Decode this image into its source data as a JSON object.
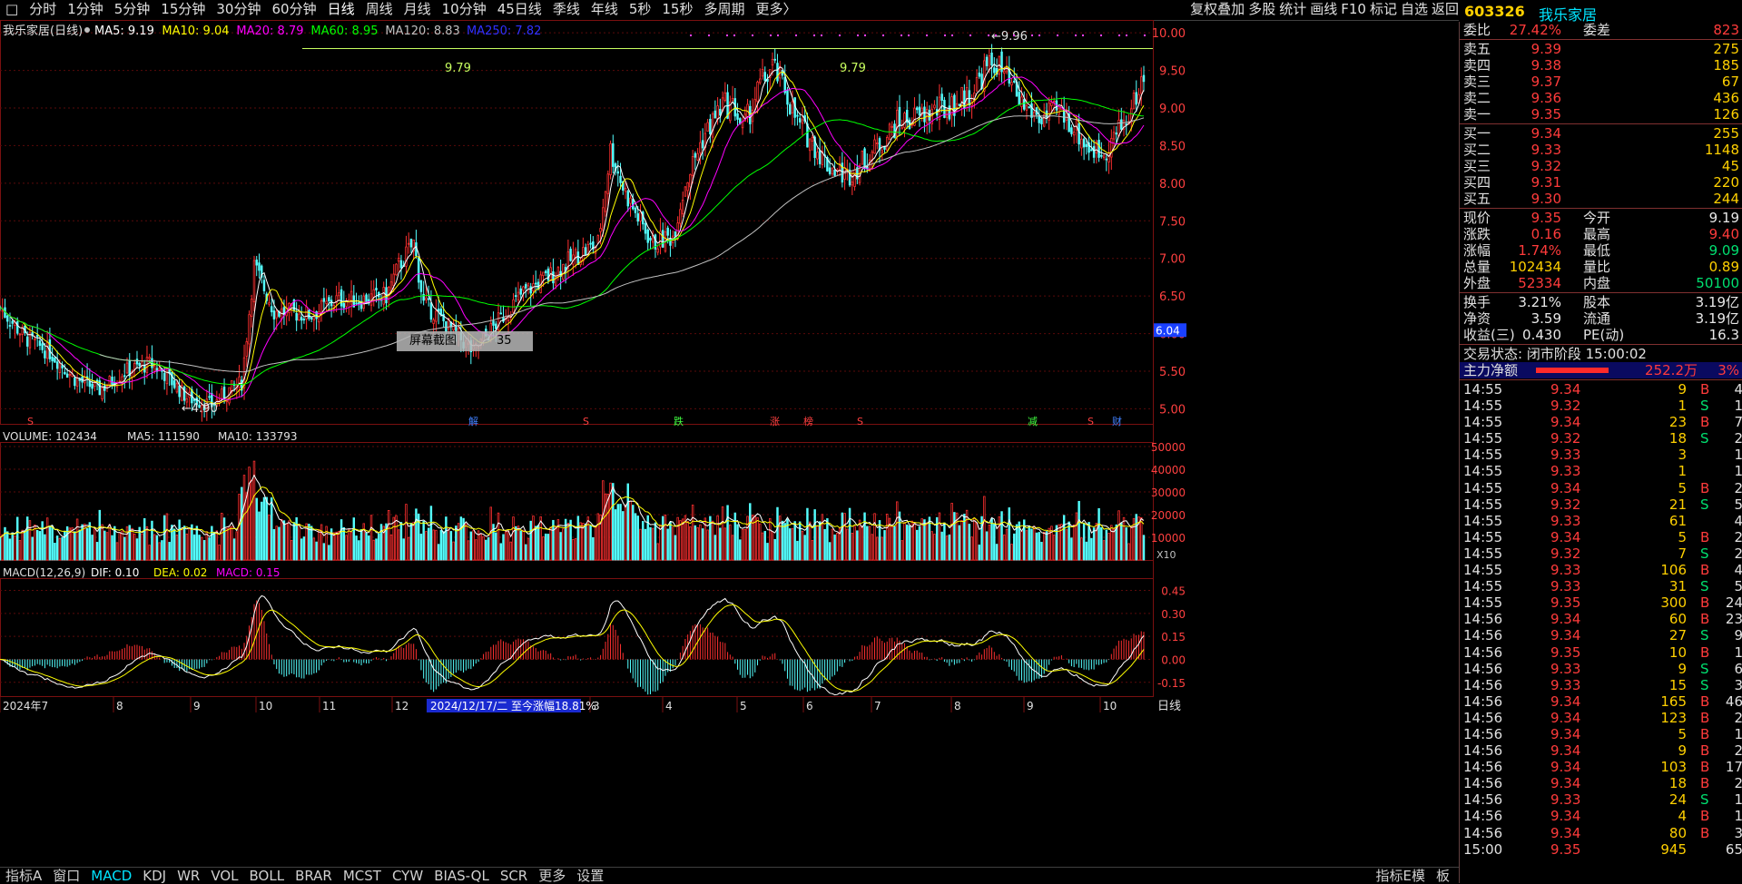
{
  "toolbar": {
    "tabs": [
      "分时",
      "1分钟",
      "5分钟",
      "15分钟",
      "30分钟",
      "60分钟",
      "日线",
      "周线",
      "月线",
      "10分钟",
      "45日线",
      "季线",
      "年线",
      "5秒",
      "15秒",
      "多周期",
      "更多〉"
    ],
    "active": "日线",
    "right_items": [
      "复权叠加",
      "多股",
      "统计",
      "画线",
      "F10",
      "标记",
      "自选",
      "返回"
    ]
  },
  "stock": {
    "code": "603326",
    "name": "我乐家居"
  },
  "main_chart": {
    "title": "我乐家居(日线)",
    "ma_legend": [
      {
        "label": "MA5: 9.19",
        "color": "#ffffff"
      },
      {
        "label": "MA10: 9.04",
        "color": "#ffff00"
      },
      {
        "label": "MA20: 8.79",
        "color": "#ff00ff"
      },
      {
        "label": "MA60: 8.95",
        "color": "#00ff00"
      },
      {
        "label": "MA120: 8.83",
        "color": "#c0c0c0"
      },
      {
        "label": "MA250: 7.82",
        "color": "#3030ff"
      }
    ],
    "price_ticks": [
      "10.00",
      "9.50",
      "9.00",
      "8.50",
      "8.00",
      "7.50",
      "7.00",
      "6.50",
      "6.00",
      "5.50",
      "5.00"
    ],
    "annotations": [
      "9.79",
      "9.79",
      "9.96",
      "4.90"
    ],
    "current_price_tag": "6.04",
    "event_marks": [
      "S",
      "解",
      "S",
      "跌",
      "涨",
      "榜",
      "S",
      "减",
      "S",
      "财"
    ],
    "overlay": {
      "label": "屏幕截图",
      "extra": "35"
    }
  },
  "volume_chart": {
    "legend": [
      "VOLUME: 102434",
      "MA5: 111590",
      "MA10: 133793"
    ],
    "ticks": [
      "50000",
      "40000",
      "30000",
      "20000",
      "10000"
    ],
    "multiplier": "X10"
  },
  "macd_chart": {
    "legend": [
      "MACD(12,26,9)",
      "DIF: 0.10",
      "DEA: 0.02",
      "MACD: 0.15"
    ],
    "ticks": [
      "0.45",
      "0.30",
      "0.15",
      "0.00",
      "-0.15"
    ]
  },
  "x_axis": {
    "labels": [
      "2024年7",
      "8",
      "9",
      "10",
      "11",
      "12",
      "3",
      "4",
      "5",
      "6",
      "7",
      "8",
      "9",
      "10"
    ],
    "highlight": "2024/12/17/二  至今涨幅18.81%",
    "period": "日线"
  },
  "bottombar": {
    "tabs": [
      "指标A",
      "窗口",
      "MACD",
      "KDJ",
      "WR",
      "VOL",
      "BOLL",
      "BRAR",
      "MCST",
      "CYW",
      "BIAS-QL",
      "SCR",
      "更多",
      "设置"
    ],
    "active": "MACD",
    "right": [
      "指标E模",
      "板"
    ]
  },
  "quote": {
    "weibi": {
      "l1": "委比",
      "v1": "27.42%",
      "l2": "委差",
      "v2": "823"
    },
    "asks": [
      {
        "label": "卖五",
        "price": "9.39",
        "vol": "275"
      },
      {
        "label": "卖四",
        "price": "9.38",
        "vol": "185"
      },
      {
        "label": "卖三",
        "price": "9.37",
        "vol": "67"
      },
      {
        "label": "卖二",
        "price": "9.36",
        "vol": "436"
      },
      {
        "label": "卖一",
        "price": "9.35",
        "vol": "126"
      }
    ],
    "bids": [
      {
        "label": "买一",
        "price": "9.34",
        "vol": "255"
      },
      {
        "label": "买二",
        "price": "9.33",
        "vol": "1148"
      },
      {
        "label": "买三",
        "price": "9.32",
        "vol": "45"
      },
      {
        "label": "买四",
        "price": "9.31",
        "vol": "220"
      },
      {
        "label": "买五",
        "price": "9.30",
        "vol": "244"
      }
    ],
    "stats": [
      {
        "l1": "现价",
        "v1": "9.35",
        "c1": "red",
        "l2": "今开",
        "v2": "9.19",
        "c2": "white"
      },
      {
        "l1": "涨跌",
        "v1": "0.16",
        "c1": "red",
        "l2": "最高",
        "v2": "9.40",
        "c2": "red"
      },
      {
        "l1": "涨幅",
        "v1": "1.74%",
        "c1": "red",
        "l2": "最低",
        "v2": "9.09",
        "c2": "green"
      },
      {
        "l1": "总量",
        "v1": "102434",
        "c1": "yellow",
        "l2": "量比",
        "v2": "0.89",
        "c2": "yellow"
      },
      {
        "l1": "外盘",
        "v1": "52334",
        "c1": "red",
        "l2": "内盘",
        "v2": "50100",
        "c2": "green"
      }
    ],
    "stats2": [
      {
        "l1": "换手",
        "v1": "3.21%",
        "l2": "股本",
        "v2": "3.19亿"
      },
      {
        "l1": "净资",
        "v1": "3.59",
        "l2": "流通",
        "v2": "3.19亿"
      },
      {
        "l1": "收益(三)",
        "v1": "0.430",
        "l2": "PE(动)",
        "v2": "16.3"
      }
    ],
    "trade_status": "交易状态: 闭市阶段 15:00:02",
    "main_flow": {
      "label": "主力净额",
      "value": "252.2万",
      "pct": "3%"
    }
  },
  "ticks": [
    {
      "t": "14:55",
      "p": "9.34",
      "v": "9",
      "s": "B",
      "n": "4",
      "pc": "red"
    },
    {
      "t": "14:55",
      "p": "9.32",
      "v": "1",
      "s": "S",
      "n": "1",
      "pc": "red"
    },
    {
      "t": "14:55",
      "p": "9.34",
      "v": "23",
      "s": "B",
      "n": "7",
      "pc": "red"
    },
    {
      "t": "14:55",
      "p": "9.32",
      "v": "18",
      "s": "S",
      "n": "2",
      "pc": "red"
    },
    {
      "t": "14:55",
      "p": "9.33",
      "v": "3",
      "s": "",
      "n": "1",
      "pc": "red"
    },
    {
      "t": "14:55",
      "p": "9.33",
      "v": "1",
      "s": "",
      "n": "1",
      "pc": "red"
    },
    {
      "t": "14:55",
      "p": "9.34",
      "v": "5",
      "s": "B",
      "n": "2",
      "pc": "red"
    },
    {
      "t": "14:55",
      "p": "9.32",
      "v": "21",
      "s": "S",
      "n": "5",
      "pc": "red"
    },
    {
      "t": "14:55",
      "p": "9.33",
      "v": "61",
      "s": "",
      "n": "4",
      "pc": "red"
    },
    {
      "t": "14:55",
      "p": "9.34",
      "v": "5",
      "s": "B",
      "n": "2",
      "pc": "red"
    },
    {
      "t": "14:55",
      "p": "9.32",
      "v": "7",
      "s": "S",
      "n": "2",
      "pc": "red"
    },
    {
      "t": "14:55",
      "p": "9.33",
      "v": "106",
      "s": "B",
      "n": "4",
      "pc": "red"
    },
    {
      "t": "14:55",
      "p": "9.33",
      "v": "31",
      "s": "S",
      "n": "5",
      "pc": "red"
    },
    {
      "t": "14:55",
      "p": "9.35",
      "v": "300",
      "s": "B",
      "n": "24",
      "pc": "red"
    },
    {
      "t": "14:56",
      "p": "9.34",
      "v": "60",
      "s": "B",
      "n": "23",
      "pc": "red"
    },
    {
      "t": "14:56",
      "p": "9.34",
      "v": "27",
      "s": "S",
      "n": "9",
      "pc": "red"
    },
    {
      "t": "14:56",
      "p": "9.35",
      "v": "10",
      "s": "B",
      "n": "1",
      "pc": "red"
    },
    {
      "t": "14:56",
      "p": "9.33",
      "v": "9",
      "s": "S",
      "n": "6",
      "pc": "red"
    },
    {
      "t": "14:56",
      "p": "9.33",
      "v": "15",
      "s": "S",
      "n": "3",
      "pc": "red"
    },
    {
      "t": "14:56",
      "p": "9.34",
      "v": "165",
      "s": "B",
      "n": "46",
      "pc": "red"
    },
    {
      "t": "14:56",
      "p": "9.34",
      "v": "123",
      "s": "B",
      "n": "2",
      "pc": "red"
    },
    {
      "t": "14:56",
      "p": "9.34",
      "v": "5",
      "s": "B",
      "n": "1",
      "pc": "red"
    },
    {
      "t": "14:56",
      "p": "9.34",
      "v": "9",
      "s": "B",
      "n": "2",
      "pc": "red"
    },
    {
      "t": "14:56",
      "p": "9.34",
      "v": "103",
      "s": "B",
      "n": "17",
      "pc": "red"
    },
    {
      "t": "14:56",
      "p": "9.34",
      "v": "18",
      "s": "B",
      "n": "2",
      "pc": "red"
    },
    {
      "t": "14:56",
      "p": "9.33",
      "v": "24",
      "s": "S",
      "n": "1",
      "pc": "red"
    },
    {
      "t": "14:56",
      "p": "9.34",
      "v": "4",
      "s": "B",
      "n": "1",
      "pc": "red"
    },
    {
      "t": "14:56",
      "p": "9.34",
      "v": "80",
      "s": "B",
      "n": "3",
      "pc": "red"
    },
    {
      "t": "15:00",
      "p": "9.35",
      "v": "945",
      "s": "",
      "n": "65",
      "pc": "red"
    }
  ],
  "chart_data": {
    "type": "candlestick",
    "title": "我乐家居(日线)",
    "ylim": [
      4.8,
      10.05
    ],
    "anchors": [
      [
        0,
        6.35
      ],
      [
        10,
        5.95
      ],
      [
        20,
        5.75
      ],
      [
        30,
        5.4
      ],
      [
        40,
        5.25
      ],
      [
        50,
        5.5
      ],
      [
        60,
        5.6
      ],
      [
        65,
        5.5
      ],
      [
        75,
        5.15
      ],
      [
        85,
        5.05
      ],
      [
        92,
        5.25
      ],
      [
        97,
        5.35
      ],
      [
        102,
        6.9
      ],
      [
        110,
        6.3
      ],
      [
        125,
        6.25
      ],
      [
        135,
        6.45
      ],
      [
        145,
        6.45
      ],
      [
        155,
        6.5
      ],
      [
        160,
        6.9
      ],
      [
        166,
        7.2
      ],
      [
        170,
        6.4
      ],
      [
        180,
        6.1
      ],
      [
        190,
        5.75
      ],
      [
        197,
        6.05
      ],
      [
        210,
        6.55
      ],
      [
        222,
        6.8
      ],
      [
        232,
        7.05
      ],
      [
        240,
        7.2
      ],
      [
        245,
        8.45
      ],
      [
        250,
        7.95
      ],
      [
        255,
        7.6
      ],
      [
        262,
        7.2
      ],
      [
        270,
        7.3
      ],
      [
        275,
        8.0
      ],
      [
        282,
        8.6
      ],
      [
        290,
        9.05
      ],
      [
        295,
        9.0
      ],
      [
        298,
        8.7
      ],
      [
        305,
        9.3
      ],
      [
        310,
        9.55
      ],
      [
        315,
        9.25
      ],
      [
        320,
        8.8
      ],
      [
        325,
        8.6
      ],
      [
        332,
        8.25
      ],
      [
        340,
        8.1
      ],
      [
        350,
        8.4
      ],
      [
        360,
        8.8
      ],
      [
        370,
        8.9
      ],
      [
        380,
        9.0
      ],
      [
        390,
        9.2
      ],
      [
        395,
        9.5
      ],
      [
        400,
        9.6
      ],
      [
        405,
        9.3
      ],
      [
        410,
        9.05
      ],
      [
        418,
        8.85
      ],
      [
        425,
        8.95
      ],
      [
        430,
        8.8
      ],
      [
        436,
        8.5
      ],
      [
        442,
        8.4
      ],
      [
        448,
        8.65
      ],
      [
        453,
        8.9
      ],
      [
        456,
        9.15
      ],
      [
        458,
        9.35
      ]
    ],
    "n": 460,
    "volume_ylim": [
      0,
      52000
    ],
    "macd_ylim": [
      -0.24,
      0.53
    ]
  }
}
